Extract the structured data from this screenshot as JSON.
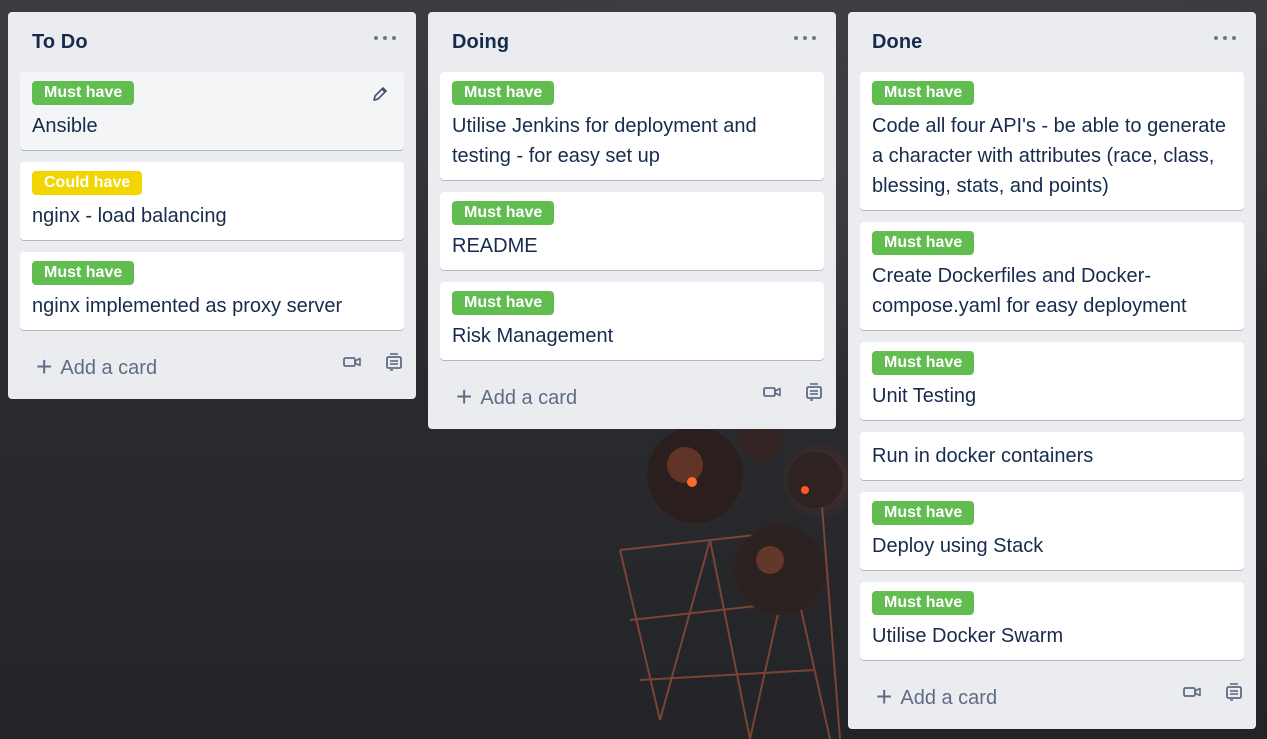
{
  "lists": [
    {
      "title": "To Do",
      "add_card_label": "Add a card",
      "cards": [
        {
          "label": "Must have",
          "label_color": "#61bd4f",
          "title": "Ansible"
        },
        {
          "label": "Could have",
          "label_color": "#f2d600",
          "title": "nginx - load balancing"
        },
        {
          "label": "Must have",
          "label_color": "#61bd4f",
          "title": "nginx implemented as proxy server"
        }
      ]
    },
    {
      "title": "Doing",
      "add_card_label": "Add a card",
      "cards": [
        {
          "label": "Must have",
          "label_color": "#61bd4f",
          "title": "Utilise Jenkins for deployment and testing - for easy set up"
        },
        {
          "label": "Must have",
          "label_color": "#61bd4f",
          "title": "README"
        },
        {
          "label": "Must have",
          "label_color": "#61bd4f",
          "title": "Risk Management"
        }
      ]
    },
    {
      "title": "Done",
      "add_card_label": "Add a card",
      "cards": [
        {
          "label": "Must have",
          "label_color": "#61bd4f",
          "title": "Code all four API's - be able to generate a character with attributes (race, class, blessing, stats, and points)"
        },
        {
          "label": "Must have",
          "label_color": "#61bd4f",
          "title": "Create Dockerfiles and Docker-compose.yaml for easy deployment"
        },
        {
          "label": "Must have",
          "label_color": "#61bd4f",
          "title": "Unit Testing"
        },
        {
          "label": "",
          "title": "Run in docker containers"
        },
        {
          "label": "Must have",
          "label_color": "#61bd4f",
          "title": "Deploy using Stack"
        },
        {
          "label": "Must have",
          "label_color": "#61bd4f",
          "title": "Utilise Docker Swarm"
        }
      ]
    }
  ],
  "icons": {
    "list_menu": "more-horizontal-icon",
    "edit": "pencil-icon",
    "add": "plus-icon",
    "video": "video-camera-icon",
    "template": "card-template-icon"
  }
}
